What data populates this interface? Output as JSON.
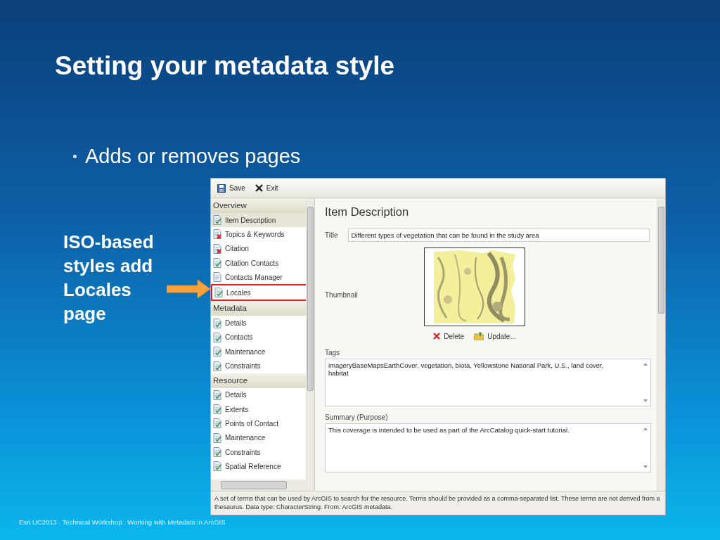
{
  "slide": {
    "title": "Setting your metadata style",
    "bullets": [
      "Adds or removes pages"
    ],
    "callout": "ISO-based styles add Locales page",
    "footer": "Esri UC2013 . Technical Workshop . Working with Metadata in ArcGIS"
  },
  "window": {
    "toolbar": [
      {
        "label": "Save",
        "kind": "save"
      },
      {
        "label": "Exit",
        "kind": "exit"
      }
    ],
    "sidebar": {
      "groups": [
        {
          "label": "Overview",
          "items": [
            {
              "label": "Item Description",
              "kind": "ok",
              "selected": true,
              "highlighted": false
            },
            {
              "label": "Topics & Keywords",
              "kind": "error",
              "selected": false,
              "highlighted": false
            },
            {
              "label": "Citation",
              "kind": "error",
              "selected": false,
              "highlighted": false
            },
            {
              "label": "Citation Contacts",
              "kind": "ok",
              "selected": false,
              "highlighted": false
            },
            {
              "label": "Contacts Manager",
              "kind": "plain",
              "selected": false,
              "highlighted": false
            },
            {
              "label": "Locales",
              "kind": "ok",
              "selected": false,
              "highlighted": true
            }
          ]
        },
        {
          "label": "Metadata",
          "items": [
            {
              "label": "Details",
              "kind": "ok",
              "selected": false,
              "highlighted": false
            },
            {
              "label": "Contacts",
              "kind": "ok",
              "selected": false,
              "highlighted": false
            },
            {
              "label": "Maintenance",
              "kind": "ok",
              "selected": false,
              "highlighted": false
            },
            {
              "label": "Constraints",
              "kind": "ok",
              "selected": false,
              "highlighted": false
            }
          ]
        },
        {
          "label": "Resource",
          "items": [
            {
              "label": "Details",
              "kind": "ok",
              "selected": false,
              "highlighted": false
            },
            {
              "label": "Extents",
              "kind": "ok",
              "selected": false,
              "highlighted": false
            },
            {
              "label": "Points of Contact",
              "kind": "ok",
              "selected": false,
              "highlighted": false
            },
            {
              "label": "Maintenance",
              "kind": "ok",
              "selected": false,
              "highlighted": false
            },
            {
              "label": "Constraints",
              "kind": "ok",
              "selected": false,
              "highlighted": false
            },
            {
              "label": "Spatial Reference",
              "kind": "ok",
              "selected": false,
              "highlighted": false
            }
          ]
        }
      ]
    },
    "main": {
      "heading": "Item Description",
      "title_label": "Title",
      "title_value": "Different types of vegetation that can be found in the study area",
      "thumbnail_label": "Thumbnail",
      "thumbnail_actions": [
        {
          "label": "Delete",
          "kind": "delete"
        },
        {
          "label": "Update...",
          "kind": "update"
        }
      ],
      "tags_label": "Tags",
      "tags_value": "imageryBaseMapsEarthCover, vegetation, biota, Yellowstone National Park, U.S., land cover, habitat",
      "summary_label": "Summary (Purpose)",
      "summary_value": "This coverage is intended to be used as part of the ArcCatalog quick-start tutorial."
    },
    "status_bar": "A set of terms that can be used by ArcGIS to search for the resource. Terms should be provided as a comma-separated list. These terms are not derived from a thesaurus. Data type: CharacterString. From: ArcGIS metadata."
  }
}
